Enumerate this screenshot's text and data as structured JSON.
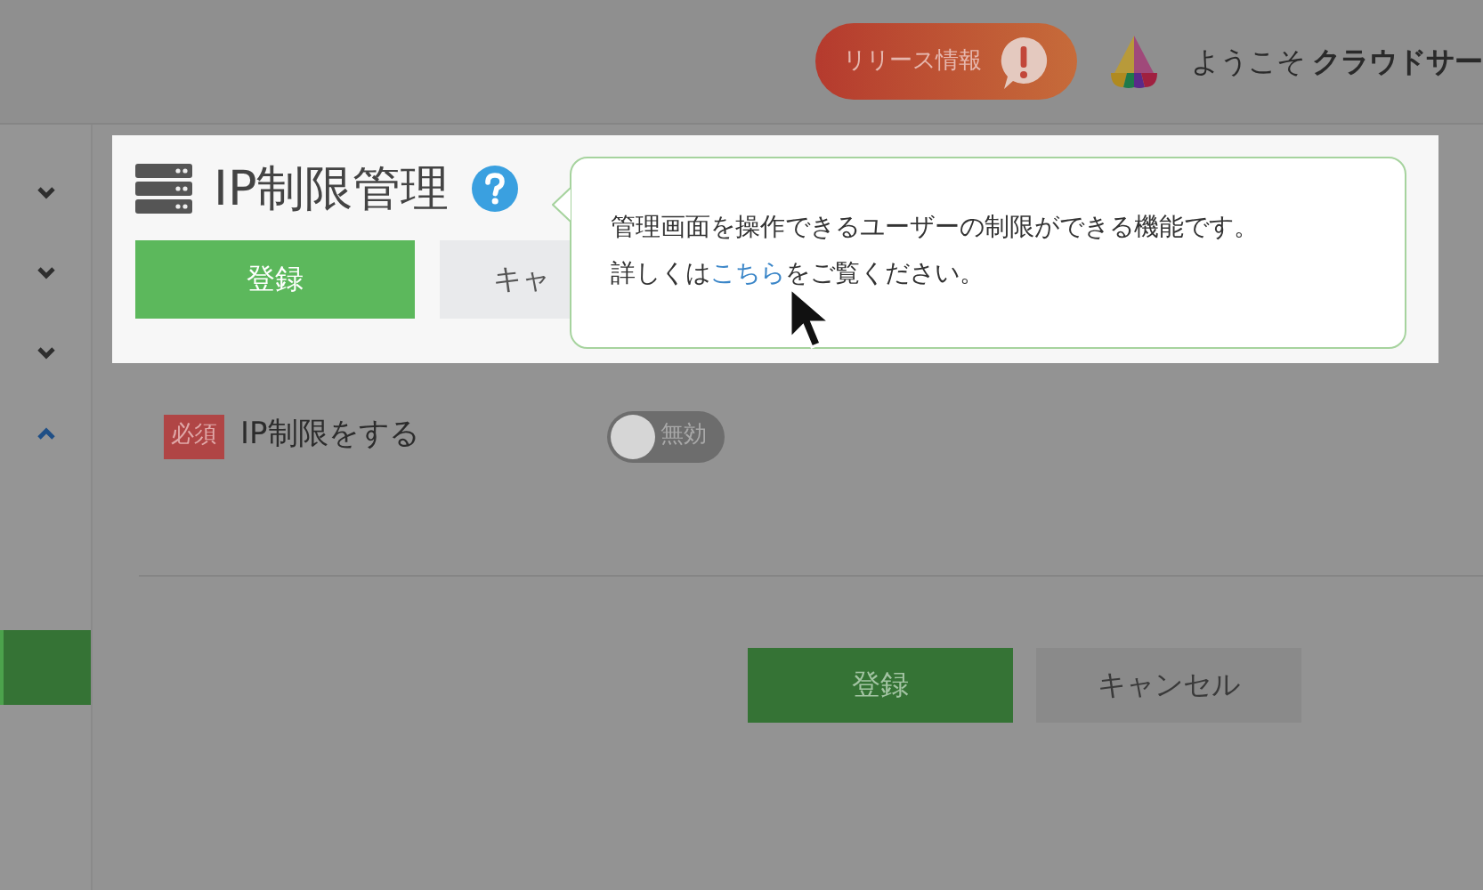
{
  "header": {
    "release_button": "リリース情報",
    "greeting": "ようこそ",
    "user_name": "クラウドサー"
  },
  "sidebar": {
    "sections": [
      {
        "expanded": false
      },
      {
        "expanded": false
      },
      {
        "expanded": false
      },
      {
        "expanded": true
      }
    ],
    "active_item": {
      "selected": true
    }
  },
  "page": {
    "title": "IP制限管理",
    "buttons": [
      {
        "label": "登録",
        "kind": "primary"
      },
      {
        "label": "キャ",
        "kind": "secondary"
      }
    ]
  },
  "tooltip": {
    "line1": "管理画面を操作できるユーザーの制限ができる機能です。",
    "before_link": "詳しくは",
    "link": "こちら",
    "after_link": "をご覧ください。"
  },
  "form": {
    "fields": [
      {
        "required_badge": "必須",
        "label": "IP制限をする",
        "toggle": {
          "on": false,
          "label": "無効"
        }
      }
    ]
  },
  "footer_buttons": [
    {
      "label": "登録",
      "kind": "primary"
    },
    {
      "label": "キャンセル",
      "kind": "secondary"
    }
  ]
}
